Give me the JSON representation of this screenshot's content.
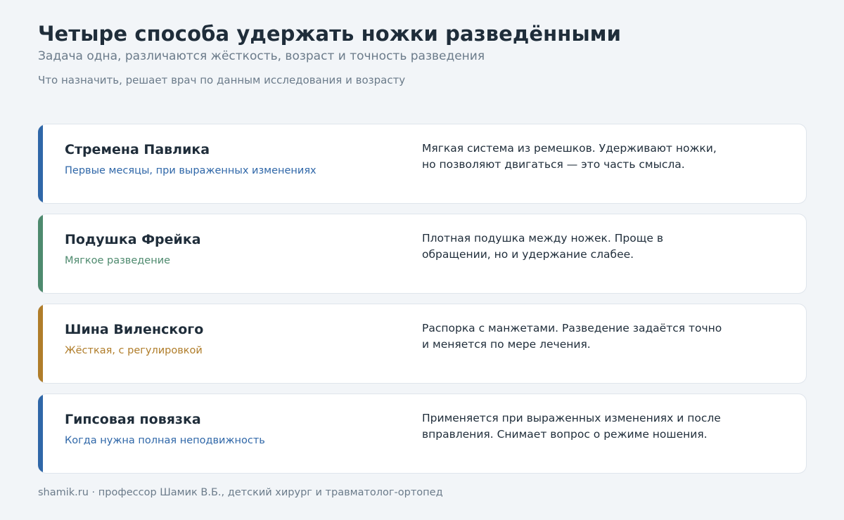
{
  "header": {
    "title": "Четыре способа удержать ножки разведёнными",
    "subtitle": "Задача одна, различаются жёсткость, возраст и точность разведения",
    "note": "Что назначить, решает врач по данным исследования и возрасту"
  },
  "colors": {
    "blue": "#2f67a8",
    "green": "#4e8a6e",
    "amber": "#b07d2a"
  },
  "cards": [
    {
      "name": "Стремена Павлика",
      "tag": "Первые месяцы, при выраженных изменениях",
      "desc": "Мягкая система из ремешков. Удерживают ножки, но позволяют двигаться — это часть смысла.",
      "accent": "#2f67a8"
    },
    {
      "name": "Подушка Фрейка",
      "tag": "Мягкое разведение",
      "desc": "Плотная подушка между ножек. Проще в обращении, но и удержание слабее.",
      "accent": "#4e8a6e"
    },
    {
      "name": "Шина Виленского",
      "tag": "Жёсткая, с регулировкой",
      "desc": "Распорка с манжетами. Разведение задаётся точно и меняется по мере лечения.",
      "accent": "#b07d2a"
    },
    {
      "name": "Гипсовая повязка",
      "tag": "Когда нужна полная неподвижность",
      "desc": "Применяется при выраженных изменениях и после вправления. Снимает вопрос о режиме ношения.",
      "accent": "#2f67a8"
    }
  ],
  "footer": {
    "text": "shamik.ru · профессор Шамик В.Б., детский хирург и травматолог-ортопед"
  }
}
